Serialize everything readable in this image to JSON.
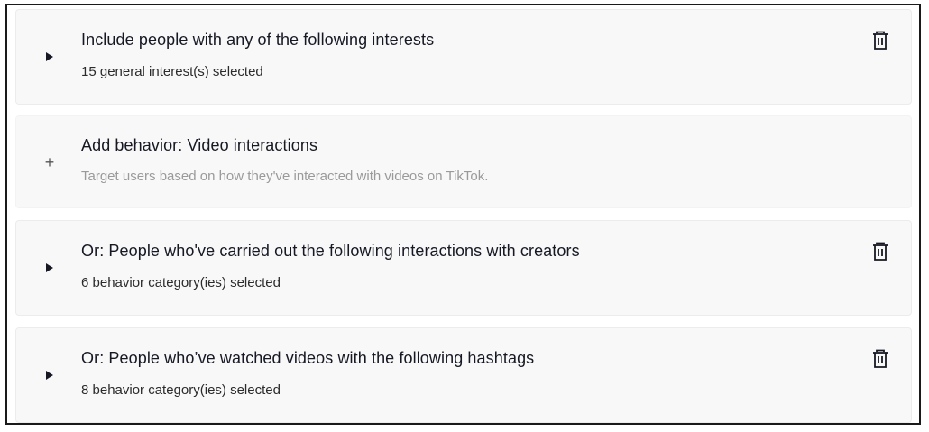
{
  "cards": [
    {
      "title": "Include people with any of the following interests",
      "subtitle": "15 general interest(s) selected"
    },
    {
      "title": "Add behavior: Video interactions",
      "subtitle": "Target users based on how they've interacted with videos on TikTok."
    },
    {
      "title": "Or: People who've carried out the following interactions with creators",
      "subtitle": "6 behavior category(ies) selected"
    },
    {
      "title": "Or: People who’ve watched videos with the following hashtags",
      "subtitle": "8 behavior category(ies) selected"
    }
  ],
  "icons": {
    "expand": "caret-right-icon",
    "add": "plus-icon",
    "delete": "trash-icon",
    "add_glyph": "+"
  }
}
